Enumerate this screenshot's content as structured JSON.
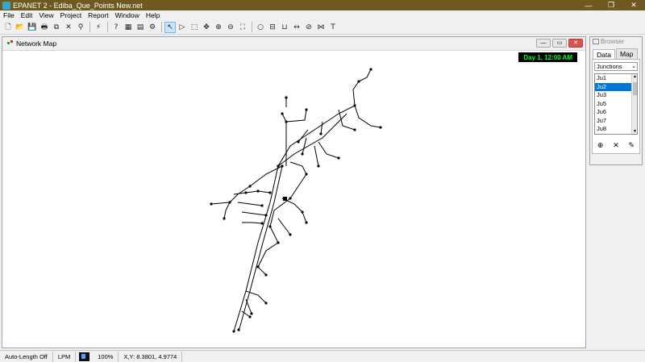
{
  "window": {
    "title": "EPANET 2 - Ediba_Que_Points New.net",
    "minimize": "—",
    "restore": "❐",
    "close": "✕"
  },
  "menu": [
    "File",
    "Edit",
    "View",
    "Project",
    "Report",
    "Window",
    "Help"
  ],
  "toolbar": {
    "icons": [
      "new-icon",
      "open-icon",
      "save-icon",
      "print-icon",
      "copy-icon",
      "delete-icon",
      "find-icon",
      "run-icon",
      "query-icon",
      "graph-icon",
      "table-icon",
      "options-icon",
      "select-object-icon",
      "select-vertex-icon",
      "select-region-icon",
      "pan-icon",
      "zoom-in-icon",
      "zoom-out-icon",
      "full-extent-icon",
      "add-junction-icon",
      "add-reservoir-icon",
      "add-tank-icon",
      "add-pipe-icon",
      "add-pump-icon",
      "add-valve-icon",
      "add-label-icon"
    ],
    "glyphs": [
      "🗋",
      "📂",
      "💾",
      "🖶",
      "⧉",
      "✕",
      "⚲",
      "⚡",
      "?",
      "▦",
      "▤",
      "⚙",
      "↖",
      "▷",
      "⬚",
      "✥",
      "⊕",
      "⊖",
      "⛶",
      "○",
      "⊟",
      "⊔",
      "↔",
      "⊘",
      "⋈",
      "T"
    ]
  },
  "map_window": {
    "title": "Network Map",
    "time_label": "Day 1, 12:00 AM",
    "btn_min": "—",
    "btn_max": "▭",
    "btn_close": "✕"
  },
  "browser": {
    "title": "Browser",
    "tabs": [
      "Data",
      "Map"
    ],
    "category": "Junctions",
    "items": [
      "Ju1",
      "Ju2",
      "Ju3",
      "Ju5",
      "Ju6",
      "Ju7",
      "Ju8"
    ],
    "selected_index": 1,
    "actions": {
      "add": "⊕",
      "delete": "✕",
      "edit": "✎"
    }
  },
  "status": {
    "auto_length": "Auto-Length Off",
    "flow_units": "LPM",
    "zoom": "100%",
    "coords": "X,Y: 8.3801, 4.9774"
  }
}
